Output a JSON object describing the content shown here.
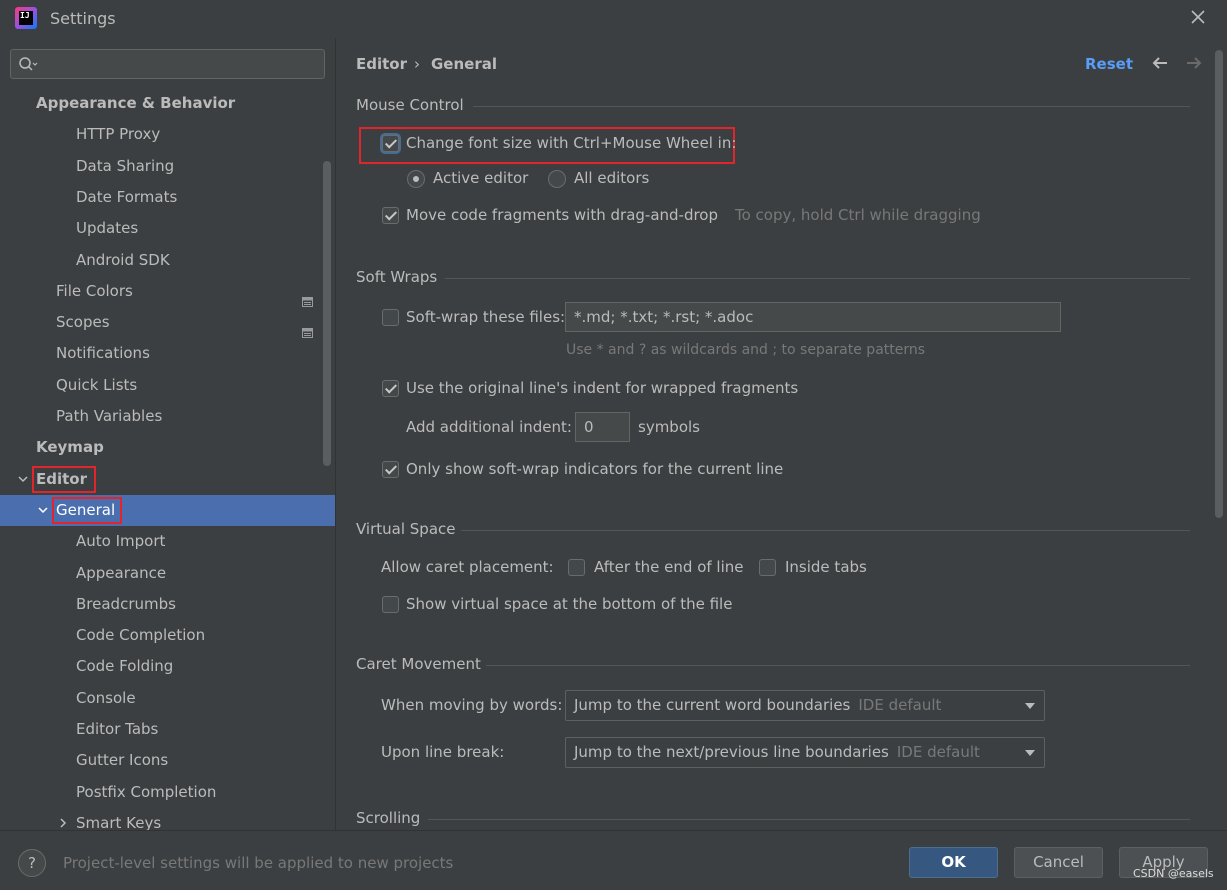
{
  "window": {
    "title": "Settings"
  },
  "sidebar": {
    "search_placeholder": "",
    "items": [
      {
        "label": "Appearance & Behavior",
        "bold": true,
        "level": 0
      },
      {
        "label": "HTTP Proxy",
        "level": 2
      },
      {
        "label": "Data Sharing",
        "level": 2
      },
      {
        "label": "Date Formats",
        "level": 2
      },
      {
        "label": "Updates",
        "level": 2
      },
      {
        "label": "Android SDK",
        "level": 2
      },
      {
        "label": "File Colors",
        "level": 1,
        "project_icon": true
      },
      {
        "label": "Scopes",
        "level": 1,
        "project_icon": true
      },
      {
        "label": "Notifications",
        "level": 1
      },
      {
        "label": "Quick Lists",
        "level": 1
      },
      {
        "label": "Path Variables",
        "level": 1
      },
      {
        "label": "Keymap",
        "bold": true,
        "level": 0
      },
      {
        "label": "Editor",
        "bold": true,
        "level": 0,
        "expanded": true,
        "highlighted": true
      },
      {
        "label": "General",
        "level": 1,
        "expanded": true,
        "selected": true,
        "highlighted": true
      },
      {
        "label": "Auto Import",
        "level": 2
      },
      {
        "label": "Appearance",
        "level": 2
      },
      {
        "label": "Breadcrumbs",
        "level": 2
      },
      {
        "label": "Code Completion",
        "level": 2
      },
      {
        "label": "Code Folding",
        "level": 2
      },
      {
        "label": "Console",
        "level": 2
      },
      {
        "label": "Editor Tabs",
        "level": 2
      },
      {
        "label": "Gutter Icons",
        "level": 2
      },
      {
        "label": "Postfix Completion",
        "level": 2
      },
      {
        "label": "Smart Keys",
        "level": 2,
        "collapsed": true
      }
    ]
  },
  "header": {
    "breadcrumb": [
      "Editor",
      "General"
    ],
    "separator": "›",
    "reset_label": "Reset"
  },
  "mouse_control": {
    "title": "Mouse Control",
    "change_font_label": "Change font size with Ctrl+Mouse Wheel in:",
    "change_font_checked": true,
    "active_editor_label": "Active editor",
    "all_editors_label": "All editors",
    "selected": "Active editor",
    "move_code_label": "Move code fragments with drag-and-drop",
    "move_code_checked": true,
    "move_code_hint": "To copy, hold Ctrl while dragging"
  },
  "soft_wraps": {
    "title": "Soft Wraps",
    "soft_wrap_label": "Soft-wrap these files:",
    "soft_wrap_checked": false,
    "soft_wrap_value": "*.md; *.txt; *.rst; *.adoc",
    "soft_wrap_hint": "Use * and ? as wildcards and ; to separate patterns",
    "original_indent_label": "Use the original line's indent for wrapped fragments",
    "original_indent_checked": true,
    "additional_indent_label": "Add additional indent:",
    "additional_indent_value": "0",
    "symbols_label": "symbols",
    "only_show_label": "Only show soft-wrap indicators for the current line",
    "only_show_checked": true
  },
  "virtual_space": {
    "title": "Virtual Space",
    "allow_caret_label": "Allow caret placement:",
    "after_end_label": "After the end of line",
    "after_end_checked": false,
    "inside_tabs_label": "Inside tabs",
    "inside_tabs_checked": false,
    "show_virtual_label": "Show virtual space at the bottom of the file",
    "show_virtual_checked": false
  },
  "caret_movement": {
    "title": "Caret Movement",
    "words_label": "When moving by words:",
    "words_value": "Jump to the current word boundaries",
    "words_default": "IDE default",
    "line_break_label": "Upon line break:",
    "line_break_value": "Jump to the next/previous line boundaries",
    "line_break_default": "IDE default"
  },
  "scrolling": {
    "title": "Scrolling"
  },
  "footer": {
    "help_label": "?",
    "info_text": "Project-level settings will be applied to new projects",
    "ok_label": "OK",
    "cancel_label": "Cancel",
    "apply_label": "Apply",
    "watermark": "CSDN @easels"
  },
  "colors": {
    "background": "#3c3f41",
    "selection": "#4b6eaf",
    "link": "#589df6",
    "highlight_box": "#e0252d",
    "primary_button": "#365880"
  }
}
